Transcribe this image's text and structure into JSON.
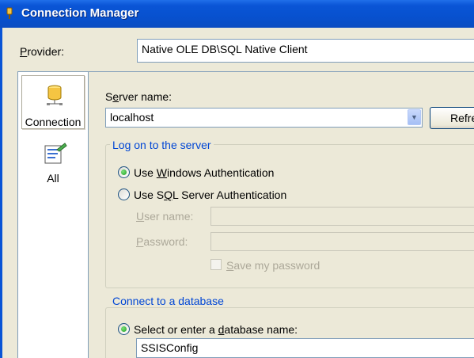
{
  "window": {
    "title": "Connection Manager"
  },
  "provider": {
    "label": "Provider:",
    "value": "Native OLE DB\\SQL Native Client"
  },
  "sidebar": {
    "items": [
      {
        "label": "Connection",
        "icon": "database-cylinder-icon"
      },
      {
        "label": "All",
        "icon": "properties-list-icon"
      }
    ]
  },
  "server": {
    "label": "Server name:",
    "value": "localhost",
    "refresh_label": "Refre"
  },
  "logon": {
    "title": "Log on to the server",
    "windows_auth": "Use Windows Authentication",
    "sql_auth": "Use SQL Server Authentication",
    "username_label": "User name:",
    "password_label": "Password:",
    "save_password": "Save my password",
    "selected": "windows"
  },
  "database": {
    "title": "Connect to a database",
    "select_label": "Select or enter a database name:",
    "value": "SSISConfig"
  },
  "colors": {
    "titlebar": "#0a55d6",
    "group_title": "#0046d5",
    "border": "#7f9db9"
  }
}
